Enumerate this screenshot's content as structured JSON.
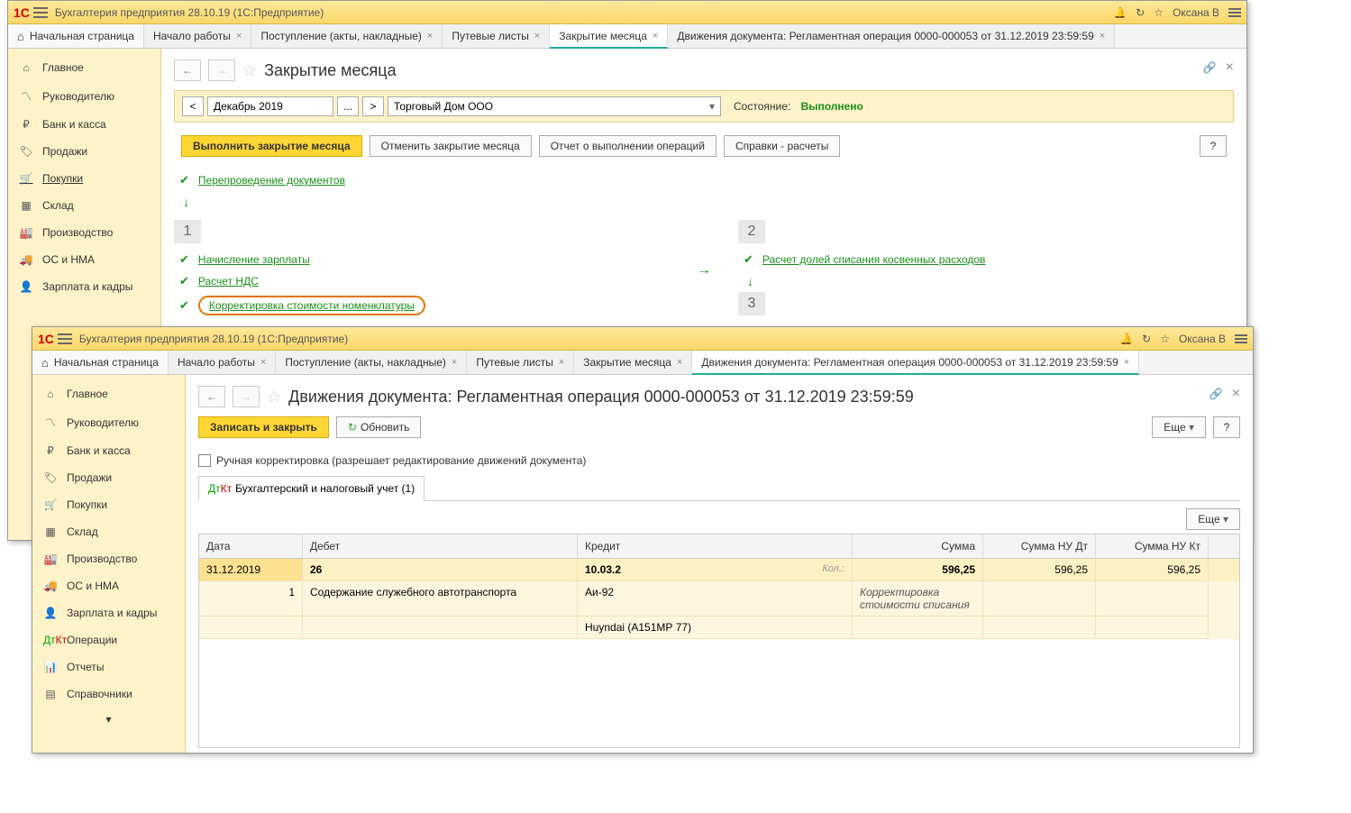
{
  "titlebar": {
    "app_title": "Бухгалтерия предприятия 28.10.19   (1С:Предприятие)",
    "user": "Оксана В"
  },
  "tabs_w1": {
    "home": "Начальная страница",
    "t1": "Начало работы",
    "t2": "Поступление (акты, накладные)",
    "t3": "Путевые листы",
    "t4": "Закрытие месяца",
    "t5": "Движения документа: Регламентная операция 0000-000053 от 31.12.2019 23:59:59"
  },
  "sidebar": {
    "s0": "Главное",
    "s1": "Руководителю",
    "s2": "Банк и касса",
    "s3": "Продажи",
    "s4": "Покупки",
    "s5": "Склад",
    "s6": "Производство",
    "s7": "ОС и НМА",
    "s8": "Зарплата и кадры",
    "s9": "Операции",
    "s10": "Отчеты",
    "s11": "Справочники"
  },
  "page1": {
    "title": "Закрытие месяца",
    "period": "Декабрь 2019",
    "ellipsis": "...",
    "org": "Торговый Дом ООО",
    "state_label": "Состояние:",
    "state_value": "Выполнено",
    "btn_run": "Выполнить закрытие месяца",
    "btn_cancel": "Отменить закрытие месяца",
    "btn_report": "Отчет о выполнении операций",
    "btn_sprav": "Справки - расчеты",
    "q": "?",
    "op_reprov": "Перепроведение документов",
    "n1": "1",
    "n2": "2",
    "n3": "3",
    "op_salary": "Начисление зарплаты",
    "op_nds": "Расчет НДС",
    "op_korr": "Корректировка стоимости номенклатуры",
    "op_indirect": "Расчет долей списания косвенных расходов"
  },
  "page2": {
    "title": "Движения документа: Регламентная операция 0000-000053 от 31.12.2019 23:59:59",
    "btn_save": "Записать и закрыть",
    "btn_refresh": "Обновить",
    "btn_more": "Еще",
    "q": "?",
    "checkbox_label": "Ручная корректировка (разрешает редактирование движений документа)",
    "subtab": "Бухгалтерский и налоговый учет (1)",
    "btn_more2": "Еще",
    "th_date": "Дата",
    "th_debit": "Дебет",
    "th_credit": "Кредит",
    "th_sum": "Сумма",
    "th_sumdt": "Сумма НУ Дт",
    "th_sumkt": "Сумма НУ Кт",
    "r1_date": "31.12.2019",
    "r1_debit": "26",
    "r1_credit": "10.03.2",
    "r1_kol": "Кол.:",
    "r1_sum": "596,25",
    "r1_sumdt": "596,25",
    "r1_sumkt": "596,25",
    "r2_num": "1",
    "r2_debit": "Содержание служебного автотранспорта",
    "r2_credit": "Аи-92",
    "r2_sum_note": "Корректировка стоимости списания",
    "r3_credit": "Huyndai (А151МР 77)"
  }
}
